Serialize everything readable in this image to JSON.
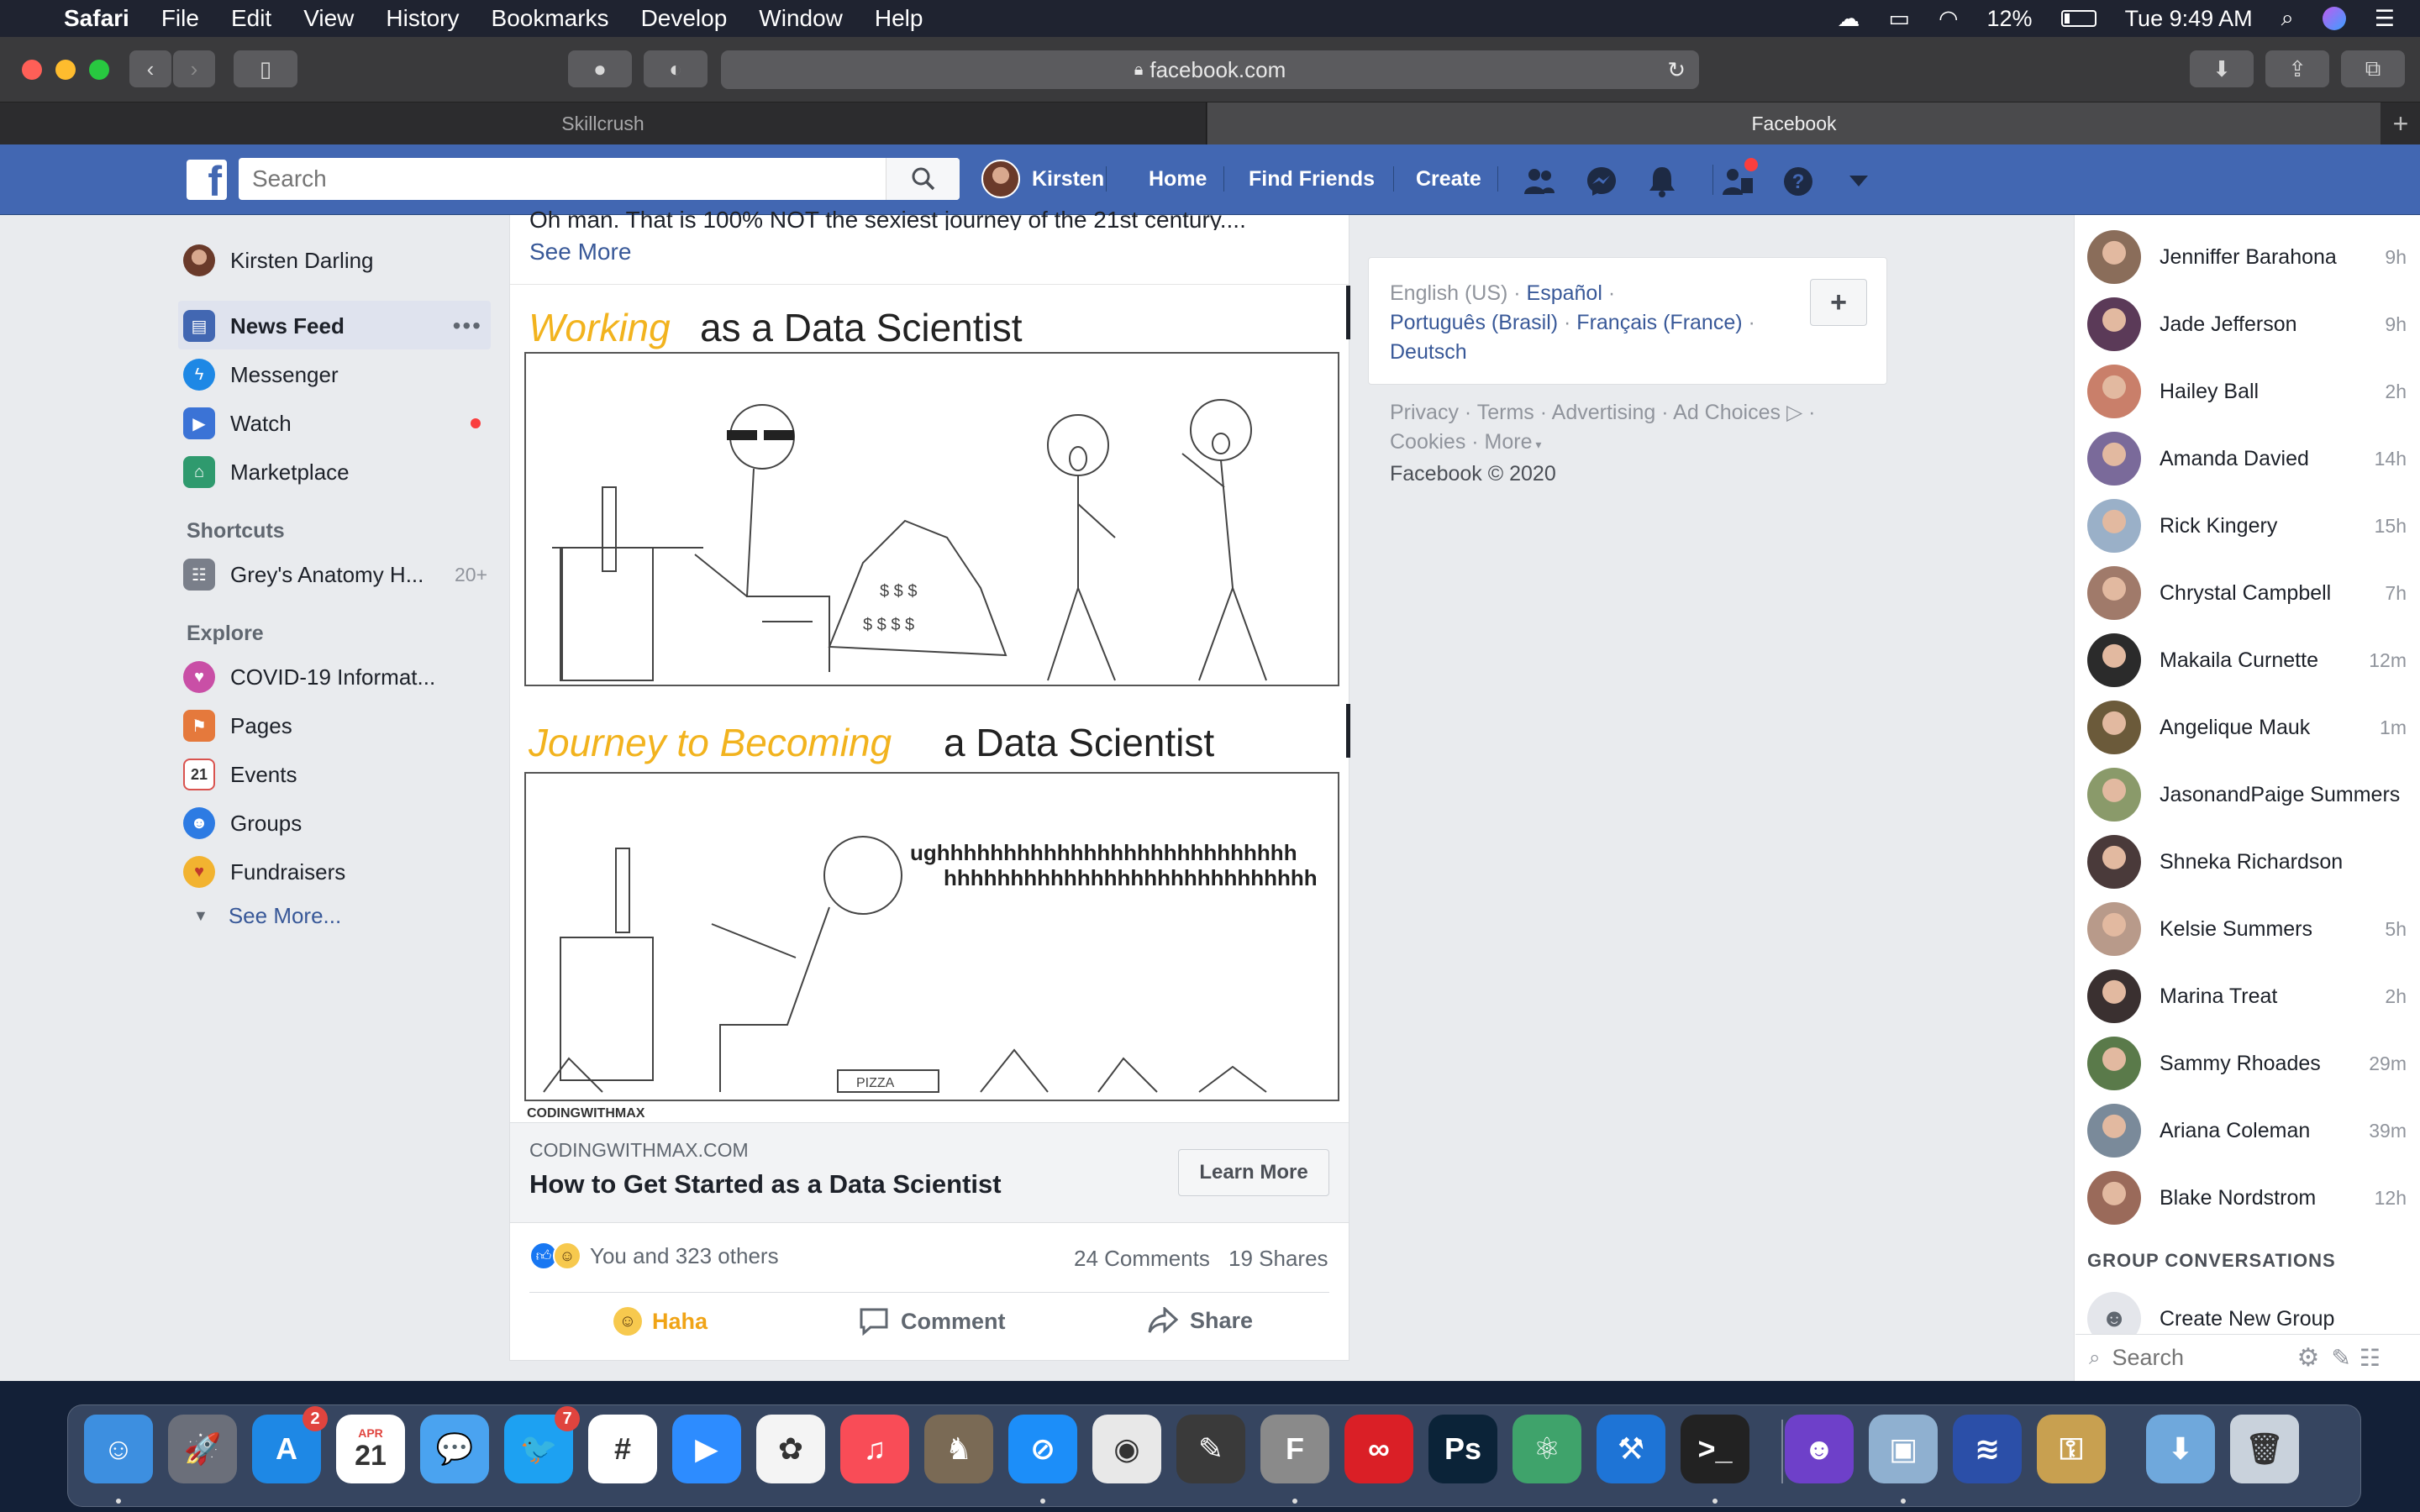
{
  "menubar": {
    "app_name": "Safari",
    "items": [
      "File",
      "Edit",
      "View",
      "History",
      "Bookmarks",
      "Develop",
      "Window",
      "Help"
    ],
    "battery": "12%",
    "clock": "Tue 9:49 AM"
  },
  "browser": {
    "url": "facebook.com",
    "tabs": [
      {
        "label": "Skillcrush",
        "active": false
      },
      {
        "label": "Facebook",
        "active": true
      }
    ],
    "new_tab": "+"
  },
  "fb_header": {
    "logo": "f",
    "search_placeholder": "Search",
    "user_name": "Kirsten",
    "links": [
      "Home",
      "Find Friends",
      "Create"
    ],
    "icons": [
      "friends-icon",
      "messenger-icon",
      "notifications-icon",
      "requests-icon",
      "help-icon",
      "menu-caret-icon"
    ],
    "accent": "#4267b2"
  },
  "left_sidebar": {
    "profile_name": "Kirsten Darling",
    "main_items": [
      {
        "label": "News Feed",
        "icon": "news-feed-icon",
        "active": true
      },
      {
        "label": "Messenger",
        "icon": "messenger-icon"
      },
      {
        "label": "Watch",
        "icon": "watch-icon",
        "dot": true
      },
      {
        "label": "Marketplace",
        "icon": "marketplace-icon"
      }
    ],
    "shortcuts_heading": "Shortcuts",
    "shortcuts": [
      {
        "label": "Grey's Anatomy H...",
        "count": "20+"
      }
    ],
    "explore_heading": "Explore",
    "explore": [
      {
        "label": "COVID-19 Informat...",
        "icon": "covid-heart-icon"
      },
      {
        "label": "Pages",
        "icon": "flag-icon"
      },
      {
        "label": "Events",
        "icon": "calendar-icon",
        "day": "21"
      },
      {
        "label": "Groups",
        "icon": "groups-icon"
      },
      {
        "label": "Fundraisers",
        "icon": "fundraiser-icon"
      }
    ],
    "see_more": "See More..."
  },
  "post": {
    "text_fragment": "Oh man. That is 100% NOT the sexiest journey of the 21st century....",
    "see_more": "See More",
    "comic": {
      "panel1_title_a": "Working",
      "panel1_title_b": "as a Data Scientist",
      "panel2_title_a": "Journey to Becoming",
      "panel2_title_b": "a Data Scientist",
      "groan_line1": "ughhhhhhhhhhhhhhhhhhhhhhhhhhh",
      "groan_line2": "hhhhhhhhhhhhhhhhhhhhhhhhhhhh",
      "box_label": "PIZZA",
      "watermark": "CODINGWITHMAX"
    },
    "link_domain": "CODINGWITHMAX.COM",
    "link_title": "How to Get Started as a Data Scientist",
    "learn_more": "Learn More",
    "reactions_text": "You and 323 others",
    "comments": "24 Comments",
    "shares": "19 Shares",
    "actions": {
      "haha": "Haha",
      "comment": "Comment",
      "share": "Share"
    }
  },
  "right_column": {
    "languages": {
      "current": "English (US)",
      "others": [
        "Español",
        "Português (Brasil)",
        "Français (France)",
        "Deutsch"
      ],
      "add_button": "+"
    },
    "footer_links": [
      "Privacy",
      "Terms",
      "Advertising",
      "Ad Choices",
      "Cookies",
      "More"
    ],
    "copyright": "Facebook © 2020"
  },
  "chat": {
    "contacts": [
      {
        "name": "Jenniffer Barahona",
        "time": "9h",
        "color": "#8a6d5a"
      },
      {
        "name": "Jade Jefferson",
        "time": "9h",
        "color": "#5b3a58"
      },
      {
        "name": "Hailey Ball",
        "time": "2h",
        "color": "#c97f6a"
      },
      {
        "name": "Amanda Davied",
        "time": "14h",
        "color": "#7a6a9a"
      },
      {
        "name": "Rick Kingery",
        "time": "15h",
        "color": "#9ab0c8"
      },
      {
        "name": "Chrystal Campbell",
        "time": "7h",
        "color": "#a07a6a"
      },
      {
        "name": "Makaila Curnette",
        "time": "12m",
        "color": "#2b2b2b"
      },
      {
        "name": "Angelique Mauk",
        "time": "1m",
        "color": "#6b5a3a"
      },
      {
        "name": "JasonandPaige Summers",
        "time": "",
        "color": "#8a9a6a"
      },
      {
        "name": "Shneka Richardson",
        "time": "",
        "color": "#4a3a3a"
      },
      {
        "name": "Kelsie Summers",
        "time": "5h",
        "color": "#b89a8a"
      },
      {
        "name": "Marina Treat",
        "time": "2h",
        "color": "#3a3030"
      },
      {
        "name": "Sammy Rhoades",
        "time": "29m",
        "color": "#5a7a4a"
      },
      {
        "name": "Ariana Coleman",
        "time": "39m",
        "color": "#7a8a9a"
      },
      {
        "name": "Blake Nordstrom",
        "time": "12h",
        "color": "#9a6a5a"
      }
    ],
    "group_heading": "GROUP CONVERSATIONS",
    "create_group": "Create New Group",
    "search_placeholder": "Search"
  },
  "dock": {
    "apps": [
      {
        "name": "finder-icon",
        "color": "#3d8fe0",
        "glyph": "☺"
      },
      {
        "name": "launchpad-icon",
        "color": "#6b6f7a",
        "glyph": "🚀"
      },
      {
        "name": "app-store-icon",
        "color": "#1e88e5",
        "glyph": "A",
        "badge": "2"
      },
      {
        "name": "calendar-icon",
        "color": "#ffffff",
        "glyph": "21",
        "month": "APR"
      },
      {
        "name": "messages-icon",
        "color": "#4aa3f0",
        "glyph": "💬"
      },
      {
        "name": "twitter-icon",
        "color": "#1da1f2",
        "glyph": "🐦",
        "badge": "7"
      },
      {
        "name": "slack-icon",
        "color": "#ffffff",
        "glyph": "#"
      },
      {
        "name": "zoom-icon",
        "color": "#2d8cff",
        "glyph": "▶"
      },
      {
        "name": "photos-icon",
        "color": "#f4f4f4",
        "glyph": "✿"
      },
      {
        "name": "music-icon",
        "color": "#f94c57",
        "glyph": "♫"
      },
      {
        "name": "chess-icon",
        "color": "#7a6a55",
        "glyph": "♞"
      },
      {
        "name": "safari-icon",
        "color": "#1c8ef9",
        "glyph": "⊘"
      },
      {
        "name": "chrome-icon",
        "color": "#e8e8e8",
        "glyph": "◉"
      },
      {
        "name": "instruments-icon",
        "color": "#3a3a3a",
        "glyph": "✎"
      },
      {
        "name": "fontbook-icon",
        "color": "#8a8a8a",
        "glyph": "F"
      },
      {
        "name": "creative-cloud-icon",
        "color": "#da1f26",
        "glyph": "∞"
      },
      {
        "name": "photoshop-icon",
        "color": "#0b2338",
        "glyph": "Ps"
      },
      {
        "name": "atom-icon",
        "color": "#3fa36b",
        "glyph": "⚛"
      },
      {
        "name": "xcode-icon",
        "color": "#1e74d6",
        "glyph": "⚒"
      },
      {
        "name": "terminal-icon",
        "color": "#222222",
        "glyph": ">_"
      },
      {
        "name": "github-desktop-icon",
        "color": "#6e40c9",
        "glyph": "☻"
      },
      {
        "name": "preview-icon",
        "color": "#8fb0d0",
        "glyph": "▣"
      },
      {
        "name": "stacks-icon",
        "color": "#2b4fa8",
        "glyph": "≋"
      },
      {
        "name": "keychain-icon",
        "color": "#c8a050",
        "glyph": "⚿"
      },
      {
        "name": "downloads-folder-icon",
        "color": "#6fa8dc",
        "glyph": "⬇"
      },
      {
        "name": "trash-icon",
        "color": "#c9d2dc",
        "glyph": "🗑"
      }
    ]
  }
}
